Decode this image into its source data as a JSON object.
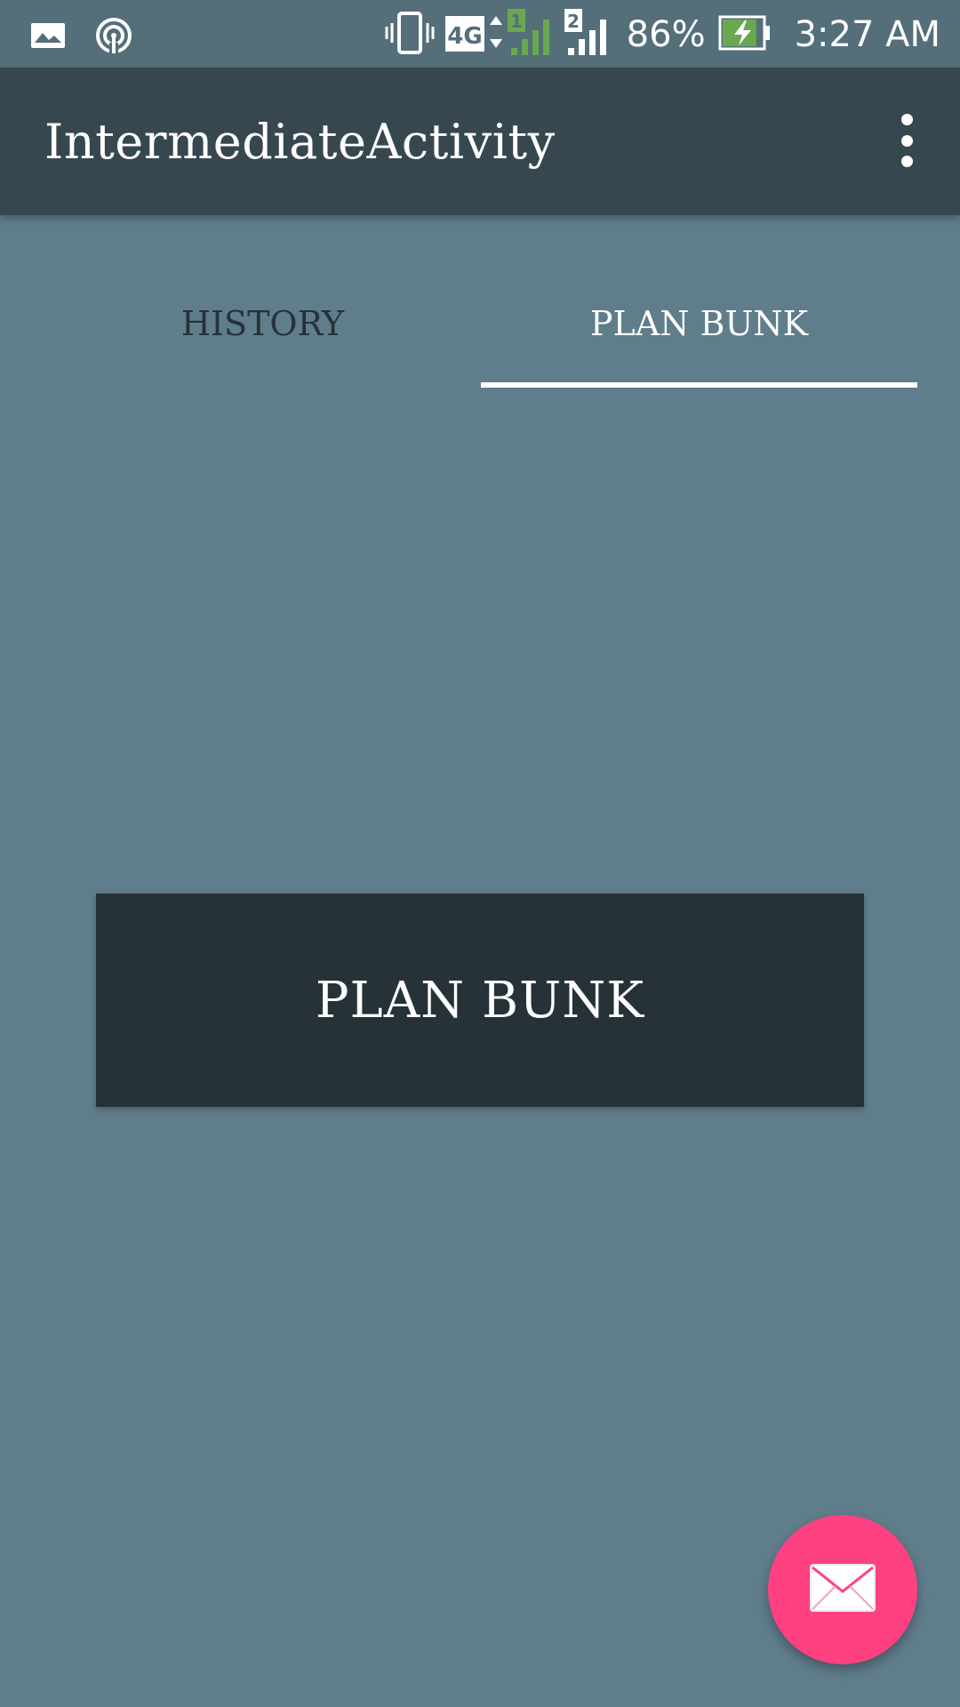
{
  "status_bar": {
    "icons_left": [
      "gallery-icon",
      "hotspot-icon"
    ],
    "icons_right": [
      "vibrate-icon",
      "network-4g-icon",
      "signal-sim1-icon",
      "signal-sim2-icon",
      "battery-charging-icon"
    ],
    "network_label": "4G",
    "sim1_label": "1",
    "sim2_label": "2",
    "battery_percent": "86%",
    "battery_level": 0.86,
    "time": "3:27 AM",
    "accent_color": "#6aa84f"
  },
  "app_bar": {
    "title": "IntermediateActivity",
    "menu_icon": "more-vert-icon"
  },
  "tabs": [
    {
      "label": "HISTORY",
      "selected": false
    },
    {
      "label": "PLAN BUNK",
      "selected": true
    }
  ],
  "main": {
    "button_label": "PLAN BUNK"
  },
  "fab": {
    "icon": "mail-icon",
    "color": "#ff4081"
  },
  "colors": {
    "background": "#607d8b",
    "app_bar": "#37474f",
    "status_bar": "#546e7a",
    "button": "#263238"
  }
}
